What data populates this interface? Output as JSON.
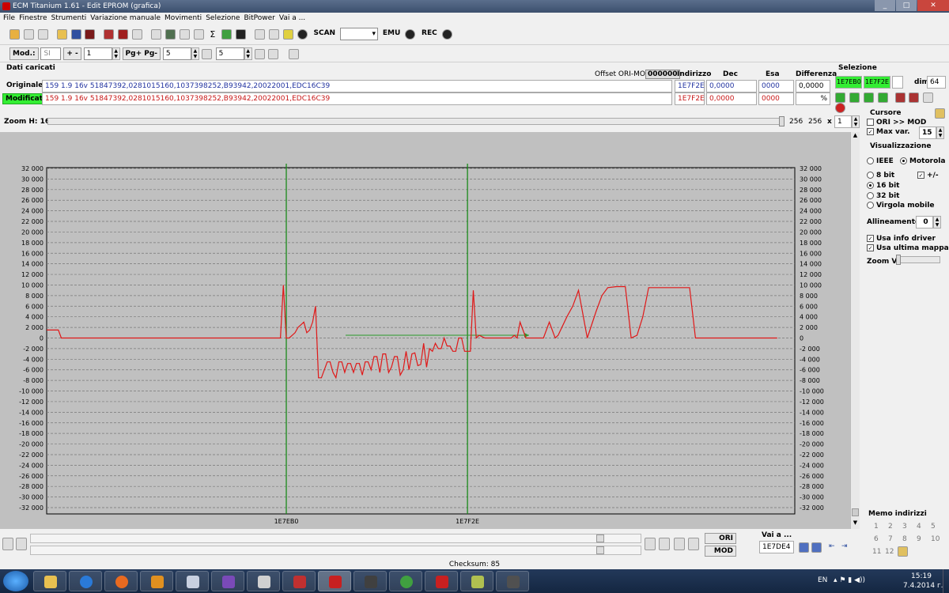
{
  "window": {
    "title": "ECM Titanium 1.61 - Edit EPROM (grafica)"
  },
  "menu": [
    "File",
    "Finestre",
    "Strumenti",
    "Variazione manuale",
    "Movimenti",
    "Selezione",
    "BitPower",
    "Vai a ..."
  ],
  "toolbar1": {
    "scan": "SCAN",
    "emu": "EMU",
    "rec": "REC"
  },
  "toolbar2": {
    "mod_label": "Mod.:",
    "mod_value": "SI",
    "plusminus": "+ -",
    "step": "1",
    "pg_label": "Pg+ Pg-",
    "pg_value": "5",
    "page_value": "5"
  },
  "dati": {
    "title": "Dati caricati",
    "offset_label": "Offset ORI-MOD",
    "offset_value": "000000",
    "col_indirizzo": "Indirizzo",
    "col_dec": "Dec",
    "col_esa": "Esa",
    "col_diff": "Differenza",
    "originale_label": "Originale",
    "modificato_label": "Modificato",
    "orig_text": "159 1.9 16v 51847392,0281015160,1037398252,B93942,20022001,EDC16C39",
    "mod_text": "159 1.9 16v 51847392,0281015160,1037398252,B93942,20022001,EDC16C39",
    "orig_addr": "1E7F2E",
    "orig_dec": "0,0000",
    "orig_esa": "0000",
    "orig_diff": "0,0000",
    "mod_addr": "1E7F2E",
    "mod_dec": "0,0000",
    "mod_esa": "0000",
    "pct": "%"
  },
  "selezione": {
    "title": "Selezione",
    "start": "1E7EB0",
    "end": "1E7F2E",
    "dim_label": "dim.",
    "dim_value": "64"
  },
  "zoom": {
    "label": "Zoom H: 16",
    "v1": "256",
    "v2": "256",
    "x": "x",
    "mult": "1"
  },
  "cursore": {
    "title": "Cursore",
    "ori_mod": "ORI >> MOD",
    "max_var": "Max var.",
    "max_var_value": "15"
  },
  "visualizzazione": {
    "title": "Visualizzazione",
    "ieee": "IEEE",
    "motorola": "Motorola",
    "b8": "8 bit",
    "pm": "+/-",
    "b16": "16 bit",
    "b32": "32 bit",
    "virgola": "Virgola mobile",
    "allineamento": "Allineamento:",
    "allineamento_value": "0",
    "usa_info": "Usa info driver",
    "usa_mappa": "Usa ultima mappa",
    "zoom_v": "Zoom V:"
  },
  "memo": {
    "title": "Memo indirizzi",
    "items": [
      "1",
      "2",
      "3",
      "4",
      "5",
      "6",
      "7",
      "8",
      "9",
      "10",
      "11",
      "12"
    ]
  },
  "bottom": {
    "ori": "ORI",
    "mod": "MOD",
    "vai_label": "Vai a ...",
    "vai_value": "1E7DE4"
  },
  "status": {
    "checksum": "Checksum: 85"
  },
  "taskbar": {
    "lang": "EN",
    "time": "15:19",
    "date": "7.4.2014 г."
  },
  "chart_data": {
    "type": "line",
    "y_ticks": [
      "32 000",
      "30 000",
      "28 000",
      "26 000",
      "24 000",
      "22 000",
      "20 000",
      "18 000",
      "16 000",
      "14 000",
      "12 000",
      "10 000",
      "8 000",
      "6 000",
      "4 000",
      "2 000",
      "0",
      "-2 000",
      "-4 000",
      "-6 000",
      "-8 000",
      "-10 000",
      "-12 000",
      "-14 000",
      "-16 000",
      "-18 000",
      "-20 000",
      "-22 000",
      "-24 000",
      "-26 000",
      "-28 000",
      "-30 000",
      "-32 000"
    ],
    "ylim": [
      -32000,
      32000
    ],
    "xlim": [
      0,
      256
    ],
    "grid": true,
    "markers": [
      {
        "x": 82,
        "label": "1E7EB0"
      },
      {
        "x": 144,
        "label": "1E7F2E"
      }
    ],
    "x": [
      0,
      4,
      5,
      80,
      81,
      82,
      83,
      85,
      86,
      88,
      89,
      90,
      91,
      92,
      93,
      94,
      96,
      97,
      98,
      99,
      100,
      101,
      102,
      103,
      104,
      105,
      106,
      107,
      108,
      109,
      110,
      111,
      112,
      113,
      114,
      115,
      116,
      117,
      118,
      119,
      120,
      121,
      122,
      123,
      124,
      125,
      126,
      127,
      128,
      129,
      130,
      131,
      132,
      133,
      134,
      135,
      136,
      137,
      138,
      139,
      140,
      141,
      142,
      143,
      144,
      145,
      146,
      147,
      148,
      150,
      152,
      155,
      157,
      159,
      160,
      161,
      162,
      164,
      166,
      167,
      168,
      170,
      172,
      174,
      175,
      178,
      180,
      182,
      185,
      188,
      190,
      192,
      195,
      198,
      200,
      202,
      204,
      206,
      208,
      210,
      215,
      220,
      222,
      224,
      230,
      250
    ],
    "y": [
      1500,
      1500,
      0,
      0,
      10000,
      0,
      0,
      1000,
      2000,
      3000,
      1000,
      1500,
      3000,
      6000,
      -7500,
      -7500,
      -4500,
      -4500,
      -6500,
      -7500,
      -4500,
      -4500,
      -6500,
      -4800,
      -4800,
      -6500,
      -4800,
      -4800,
      -7000,
      -4500,
      -4500,
      -6000,
      -3500,
      -3500,
      -6500,
      -3000,
      -3000,
      -6500,
      -5500,
      -3500,
      -3500,
      -7000,
      -6000,
      -2500,
      -6000,
      -3000,
      -2800,
      -5200,
      -5000,
      -1000,
      -5500,
      -2000,
      -2500,
      -1000,
      -2000,
      -2000,
      0,
      -1500,
      -1500,
      -2500,
      -2500,
      0,
      0,
      -2500,
      -2500,
      -2500,
      9000,
      0,
      500,
      0,
      0,
      0,
      0,
      0,
      500,
      0,
      3000,
      0,
      0,
      0,
      0,
      0,
      3000,
      0,
      500,
      4000,
      6000,
      9000,
      0,
      5000,
      8000,
      9500,
      9700,
      9700,
      0,
      500,
      4000,
      9500,
      9500,
      9500,
      9500,
      9500,
      0,
      0,
      0,
      0
    ]
  }
}
